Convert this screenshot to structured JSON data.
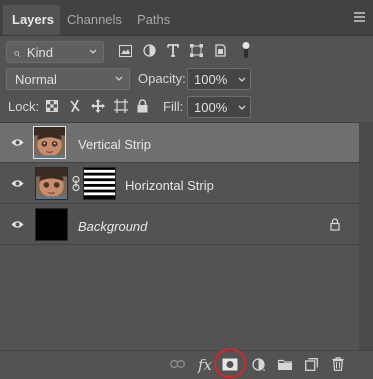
{
  "tabs": [
    {
      "label": "Layers",
      "active": true
    },
    {
      "label": "Channels",
      "active": false
    },
    {
      "label": "Paths",
      "active": false
    }
  ],
  "filter": {
    "search_glyph": "⌕",
    "kind_label": "Kind"
  },
  "blend": {
    "mode": "Normal",
    "opacity_label": "Opacity:",
    "opacity_value": "100%"
  },
  "lock": {
    "label": "Lock:",
    "fill_label": "Fill:",
    "fill_value": "100%"
  },
  "layers": [
    {
      "name": "Vertical Strip",
      "selected": true,
      "visible": true
    },
    {
      "name": "Horizontal Strip",
      "selected": false,
      "visible": true,
      "has_mask": true
    },
    {
      "name": "Background",
      "selected": false,
      "visible": true,
      "locked": true
    }
  ],
  "bottom": {
    "fx_label": "fx"
  },
  "colors": {
    "panel": "#535353",
    "tabbar": "#424242",
    "selected_row": "#6f6f6f",
    "highlight": "#d4262b"
  }
}
